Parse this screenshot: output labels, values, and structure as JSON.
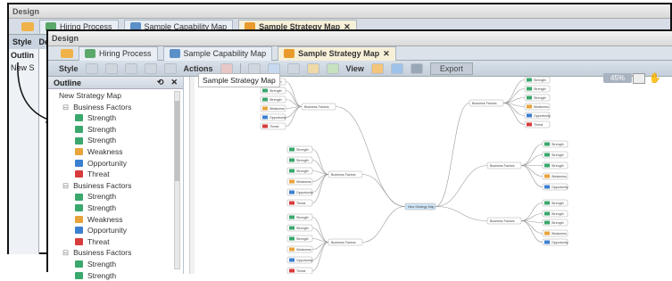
{
  "back_window": {
    "title": "Design",
    "tabs": [
      {
        "label": "Hiring Process"
      },
      {
        "label": "Sample Capability Map"
      },
      {
        "label": "Sample Strategy Map",
        "close": "✕"
      }
    ],
    "style_label": "Style",
    "design_label": "Design",
    "outline_label": "Outlin",
    "new_label": "New S"
  },
  "front_window": {
    "title": "Design",
    "tabs": [
      {
        "label": "Hiring Process"
      },
      {
        "label": "Sample Capability Map"
      },
      {
        "label": "Sample Strategy Map",
        "close": "✕"
      }
    ],
    "toolbar": {
      "style_label": "Style",
      "actions_label": "Actions",
      "view_label": "View",
      "export_label": "Export"
    },
    "outline": {
      "header": "Outline",
      "root": "New Strategy Map",
      "items": [
        {
          "label": "Business Factors",
          "type": "group"
        },
        {
          "label": "Strength",
          "type": "strength"
        },
        {
          "label": "Strength",
          "type": "strength"
        },
        {
          "label": "Strength",
          "type": "strength"
        },
        {
          "label": "Weakness",
          "type": "weakness"
        },
        {
          "label": "Opportunity",
          "type": "opportunity"
        },
        {
          "label": "Threat",
          "type": "threat"
        },
        {
          "label": "Business Factors",
          "type": "group"
        },
        {
          "label": "Strength",
          "type": "strength"
        },
        {
          "label": "Strength",
          "type": "strength"
        },
        {
          "label": "Weakness",
          "type": "weakness"
        },
        {
          "label": "Opportunity",
          "type": "opportunity"
        },
        {
          "label": "Threat",
          "type": "threat"
        },
        {
          "label": "Business Factors",
          "type": "group"
        },
        {
          "label": "Strength",
          "type": "strength"
        },
        {
          "label": "Strength",
          "type": "strength"
        }
      ]
    },
    "canvas": {
      "tab_title": "Sample Strategy Map",
      "zoom": "45%",
      "center_node": "New Strategy Map",
      "branch_label": "Business Factors",
      "leaf_labels": [
        "Strength",
        "Weakness",
        "Opportunity",
        "Threat"
      ]
    }
  },
  "colors": {
    "strength": "#3aa76d",
    "weakness": "#e8a33a",
    "opportunity": "#3b7fd1",
    "threat": "#d83b3b",
    "accent_tab": "#f7f0d8",
    "toolbar": "#c5cfdb"
  }
}
